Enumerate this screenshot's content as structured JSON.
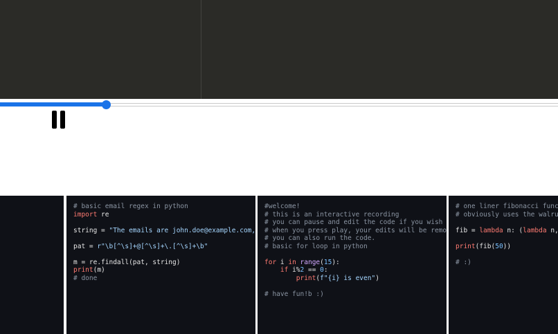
{
  "player": {
    "progress": 0.19,
    "accent_color": "#1a73e8",
    "pause_icon": "pause-icon"
  },
  "cards": [
    {
      "id": "card-0",
      "lines": []
    },
    {
      "id": "card-email-regex",
      "lines": [
        "# basic email regex in python",
        "import re",
        "",
        "string = \"The emails are john.doe@example.com, al",
        "",
        "pat = r\"\\b[^\\s]+@[^\\s]+\\.[^\\s]+\\b\"",
        "",
        "m = re.findall(pat, string)",
        "print(m)",
        "# done"
      ]
    },
    {
      "id": "card-welcome",
      "lines": [
        "#welcome!",
        "# this is an interactive recording",
        "# you can pause and edit the code if you wish",
        "# when you press play, your edits will be removed",
        "# you can also run the code.",
        "# basic for loop in python",
        "",
        "for i in range(15):",
        "    if i%2 == 0:",
        "        print(f\"{i} is even\")",
        "",
        "# have fun!b :)"
      ]
    },
    {
      "id": "card-fibonacci",
      "lines": [
        "# one liner fibonacci functi",
        "# obviously uses the walrus",
        "",
        "fib = lambda n: (lambda n, l",
        "",
        "print(fib(50))",
        "",
        "# :)"
      ]
    }
  ]
}
